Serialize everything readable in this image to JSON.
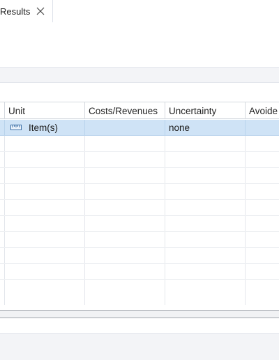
{
  "tab": {
    "label": "Results"
  },
  "table": {
    "columns": [
      "Unit",
      "Costs/Revenues",
      "Uncertainty",
      "Avoide"
    ],
    "rows": [
      {
        "unit": "Item(s)",
        "costs": "",
        "uncertainty": "none",
        "avoided": ""
      }
    ]
  },
  "colors": {
    "selection": "#cfe3f6",
    "grid": "#e4e7ec",
    "header_border": "#d5d9df"
  }
}
